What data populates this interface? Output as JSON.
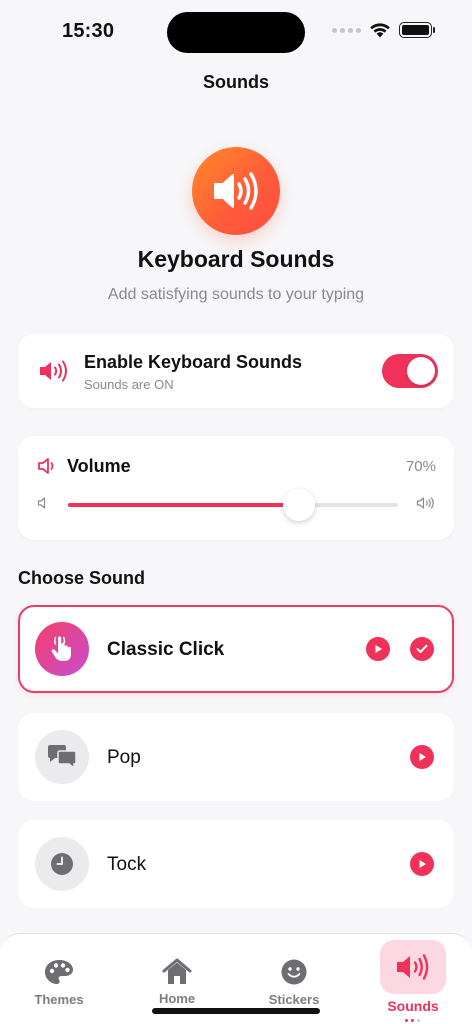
{
  "status_bar": {
    "time": "15:30"
  },
  "nav": {
    "title": "Sounds"
  },
  "hero": {
    "icon": "speaker-wave-icon",
    "title": "Keyboard Sounds",
    "subtitle": "Add satisfying sounds to your typing"
  },
  "enable": {
    "icon": "speaker-wave-icon",
    "title": "Enable Keyboard Sounds",
    "subtitle": "Sounds are ON",
    "enabled": true
  },
  "volume": {
    "title": "Volume",
    "value_text": "70%",
    "value_fraction": 0.7
  },
  "choose_section": {
    "title": "Choose Sound"
  },
  "sounds": [
    {
      "name": "Classic Click",
      "icon": "tap-hand-icon",
      "selected": true
    },
    {
      "name": "Pop",
      "icon": "chat-bubbles-icon",
      "selected": false
    },
    {
      "name": "Tock",
      "icon": "clock-icon",
      "selected": false
    }
  ],
  "tabs": [
    {
      "label": "Themes",
      "icon": "palette-icon"
    },
    {
      "label": "Home",
      "icon": "house-icon"
    },
    {
      "label": "Stickers",
      "icon": "smiley-icon"
    },
    {
      "label": "Sounds",
      "icon": "speaker-wave-icon",
      "active": true
    }
  ],
  "colors": {
    "accent": "#f0325a",
    "hero_gradient_start": "#ff8a2a",
    "hero_gradient_end": "#ff4d42"
  }
}
